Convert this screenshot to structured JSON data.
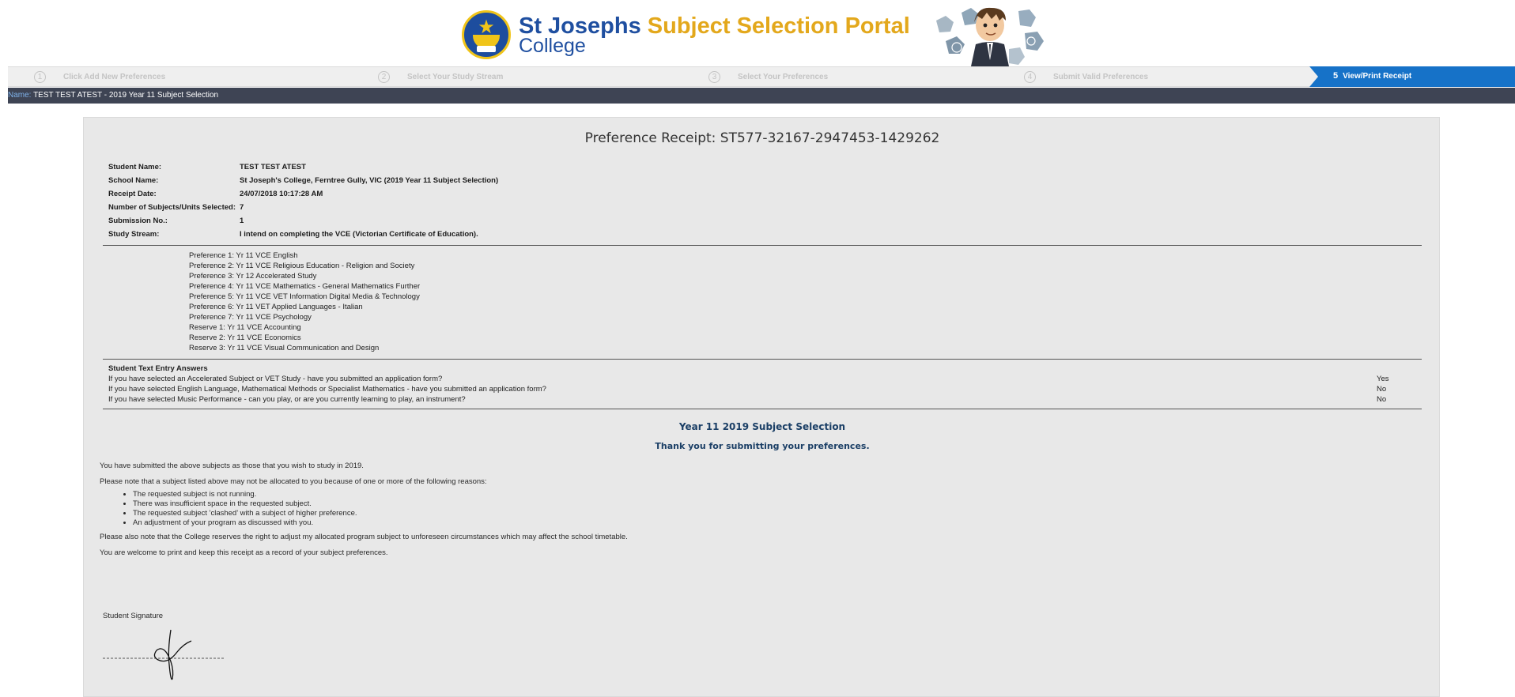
{
  "header": {
    "brand_school": "St Josephs",
    "brand_portal": "Subject Selection Portal",
    "brand_college": "College"
  },
  "steps": [
    {
      "num": "1",
      "label": "Click Add New Preferences"
    },
    {
      "num": "2",
      "label": "Select Your Study Stream"
    },
    {
      "num": "3",
      "label": "Select Your Preferences"
    },
    {
      "num": "4",
      "label": "Submit Valid Preferences"
    },
    {
      "num": "5",
      "label": "View/Print Receipt"
    }
  ],
  "namebar": {
    "label": "Name:",
    "value": "TEST TEST ATEST - 2019 Year 11 Subject Selection"
  },
  "receipt": {
    "title": "Preference Receipt: ST577-32167-2947453-1429262",
    "info": [
      {
        "label": "Student Name:",
        "value": "TEST TEST ATEST"
      },
      {
        "label": "School Name:",
        "value": "St Joseph's College, Ferntree Gully, VIC (2019 Year 11 Subject Selection)"
      },
      {
        "label": "Receipt Date:",
        "value": "24/07/2018 10:17:28 AM"
      },
      {
        "label": "Number of Subjects/Units Selected:",
        "value": "7"
      },
      {
        "label": "Submission No.:",
        "value": "1"
      },
      {
        "label": "Study Stream:",
        "value": "I intend on completing the VCE (Victorian Certificate of Education)."
      }
    ],
    "preferences": [
      "Preference 1: Yr 11 VCE English",
      "Preference 2: Yr 11 VCE Religious Education - Religion and Society",
      "Preference 3: Yr 12 Accelerated Study",
      "Preference 4: Yr 11 VCE Mathematics - General Mathematics Further",
      "Preference 5: Yr 11 VCE VET Information Digital Media & Technology",
      "Preference 6: Yr 11 VET Applied Languages - Italian",
      "Preference 7: Yr 11 VCE Psychology",
      "Reserve 1: Yr 11 VCE Accounting",
      "Reserve 2: Yr 11 VCE Economics",
      "Reserve 3: Yr 11 VCE Visual Communication and Design"
    ],
    "answers_heading": "Student Text Entry Answers",
    "answers": [
      {
        "question": "If you have selected an Accelerated Subject or VET Study - have you submitted an application form?",
        "answer": "Yes"
      },
      {
        "question": "If you have selected English Language, Mathematical Methods or Specialist Mathematics - have you submitted an application form?",
        "answer": "No"
      },
      {
        "question": "If you have selected Music Performance - can you play, or are you currently learning to play, an instrument?",
        "answer": "No"
      }
    ],
    "thanks_title": "Year 11 2019 Subject Selection",
    "thanks_sub": "Thank you for submitting your preferences.",
    "note_submitted": "You have submitted the above subjects as those that you wish to study in 2019.",
    "note_please": "Please note that a subject listed above may not be allocated to you because of one or more of the following reasons:",
    "reasons": [
      "The requested subject is not running.",
      "There was insufficient space in the requested subject.",
      "The requested subject 'clashed' with a subject of higher preference.",
      "An adjustment of your program as discussed with you."
    ],
    "note_reserves": "Please also note that the College reserves the right to adjust my allocated program subject to unforeseen circumstances which may affect the school timetable.",
    "note_print": "You are welcome to print and keep this receipt as a record of your subject preferences.",
    "signature_label": "Student Signature"
  },
  "colors": {
    "brand_blue": "#1f4fa0",
    "brand_gold": "#e3a81c",
    "step_active": "#1672c8",
    "namebar_bg": "#3e4454",
    "panel_bg": "#e8e8e8",
    "heading_navy": "#1b3f66"
  },
  "icons": {
    "crest": "college-crest-icon",
    "header_art": "student-cartoon-icon"
  }
}
